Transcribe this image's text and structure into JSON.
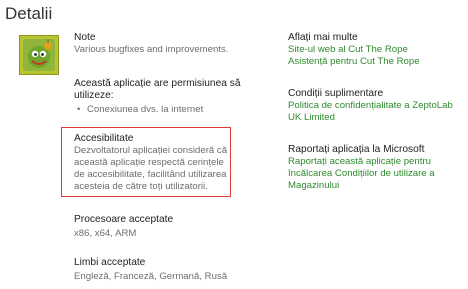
{
  "page": {
    "title": "Detalii"
  },
  "app_icon": {
    "name": "cut-the-rope-icon"
  },
  "left": {
    "notes": {
      "heading": "Note",
      "text": "Various bugfixes and improvements."
    },
    "permissions": {
      "heading": "Această aplicație are permisiunea să utilizeze:",
      "items": [
        "Conexiunea dvs. la internet"
      ]
    },
    "accessibility": {
      "heading": "Accesibilitate",
      "text": "Dezvoltatorul aplicației consideră că această aplicație respectă cerințele de accesibilitate, facilitând utilizarea acesteia de către toți utilizatorii."
    },
    "processors": {
      "heading": "Procesoare acceptate",
      "text": "x86, x64, ARM"
    },
    "languages": {
      "heading": "Limbi acceptate",
      "text": "Engleză, Franceză, Germană, Rusă"
    }
  },
  "right": {
    "learn_more": {
      "heading": "Aflați mai multe",
      "links": [
        "Site-ul web al Cut The Rope",
        "Asistență pentru Cut The Rope"
      ]
    },
    "terms": {
      "heading": "Condiții suplimentare",
      "links": [
        "Politica de confidențialitate a ZeptoLab UK Limited"
      ]
    },
    "report": {
      "heading": "Raportați aplicația la Microsoft",
      "links": [
        "Raportați această aplicație pentru încălcarea Condițiilor de utilizare a Magazinului"
      ]
    }
  },
  "colors": {
    "link": "#2f8a2f",
    "highlight": "#e23a3a",
    "icon_bg": "#c0c92e"
  }
}
